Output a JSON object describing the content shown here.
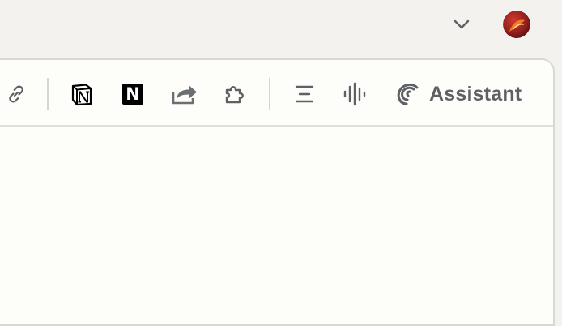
{
  "titlebar": {
    "chevron_icon": "chevron-down-icon",
    "profile_icon": "profile-avatar",
    "profile_colors": [
      "#8c1d1d",
      "#e8552a"
    ]
  },
  "toolbar": {
    "link_icon": "link-icon",
    "notion_outline_icon": "notion-outline-icon",
    "notion_letter": "N",
    "share_icon": "share-icon",
    "extensions_icon": "puzzle-icon",
    "outline_icon": "align-center-icon",
    "voice_icon": "waveform-icon",
    "assistant_icon": "assistant-icon",
    "assistant_label": "Assistant",
    "icon_color": "#5d6064"
  }
}
